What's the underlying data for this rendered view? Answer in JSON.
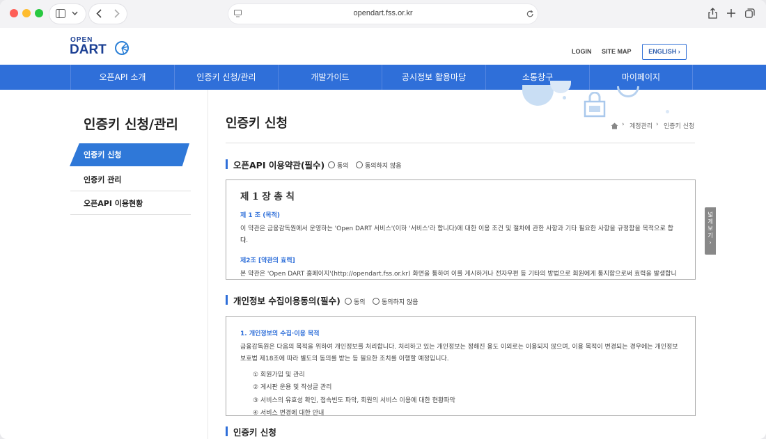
{
  "browser": {
    "url": "opendart.fss.or.kr"
  },
  "header": {
    "logo_top": "OPEN",
    "logo_main": "DART",
    "login": "LOGIN",
    "sitemap": "SITE MAP",
    "english": "ENGLISH"
  },
  "gnb": [
    "오픈API 소개",
    "인증키 신청/관리",
    "개발가이드",
    "공시정보 활용마당",
    "소통창구",
    "마이페이지"
  ],
  "lnb": {
    "title": "인증키 신청/관리",
    "items": [
      "인증키 신청",
      "인증키 관리",
      "오픈API 이용현황"
    ]
  },
  "main": {
    "title": "인증키 신청",
    "breadcrumb": [
      "계정관리",
      "인증키 신청"
    ],
    "section1": {
      "title": "오픈API 이용약관(필수)",
      "agree": "동의",
      "disagree": "동의하지 않음",
      "heading": "제 1 장 총 칙",
      "art1_title": "제 1 조 (목적)",
      "art1_text_1": "이 약관은 금융감독원에서 운영하는 'Open DART 서비스'(이하 '서비스'라 합니다)에 대한 이용 조건 및 절차에 관한 사항과 기타 필요한 사항을 규정함을 목적으로 합니",
      "art1_text_2": "다.",
      "art2_title": "제2조 [약관의 효력]",
      "art2_text": "본 약관은 'Open DART 홈페이지'(http://opendart.fss.or.kr) 화면을 통하여 이를 게시하거나 전자우편 등 기타의 방법으로 회원에게 통지함으로써 효력을 발생합니다."
    },
    "section2": {
      "title": "개인정보 수집이용동의(필수)",
      "agree": "동의",
      "disagree": "동의하지 않음",
      "item_title": "1. 개인정보의 수집·이용 목적",
      "text_1": "금융감독원은 다음의 목적을 위하여 개인정보를 처리합니다. 처리하고 있는 개인정보는 정해진 용도 이외로는 이용되지 않으며, 이용 목적이 변경되는 경우에는 개인정보",
      "text_2": "보호법 제18조에 따라 별도의 동의를 받는 등 필요한 조치를 이행할 예정입니다.",
      "list": [
        "① 회원가입 및 관리",
        "② 게시판 운용 및 작성글 관리",
        "③ 서비스의 유효성 확인, 접속빈도 파악, 회원의 서비스 이용에 대한 현황파악",
        "④ 서비스 변경에 대한 안내"
      ]
    },
    "section3": {
      "title": "인증키 신청"
    }
  },
  "side_tab": "넓게보기"
}
